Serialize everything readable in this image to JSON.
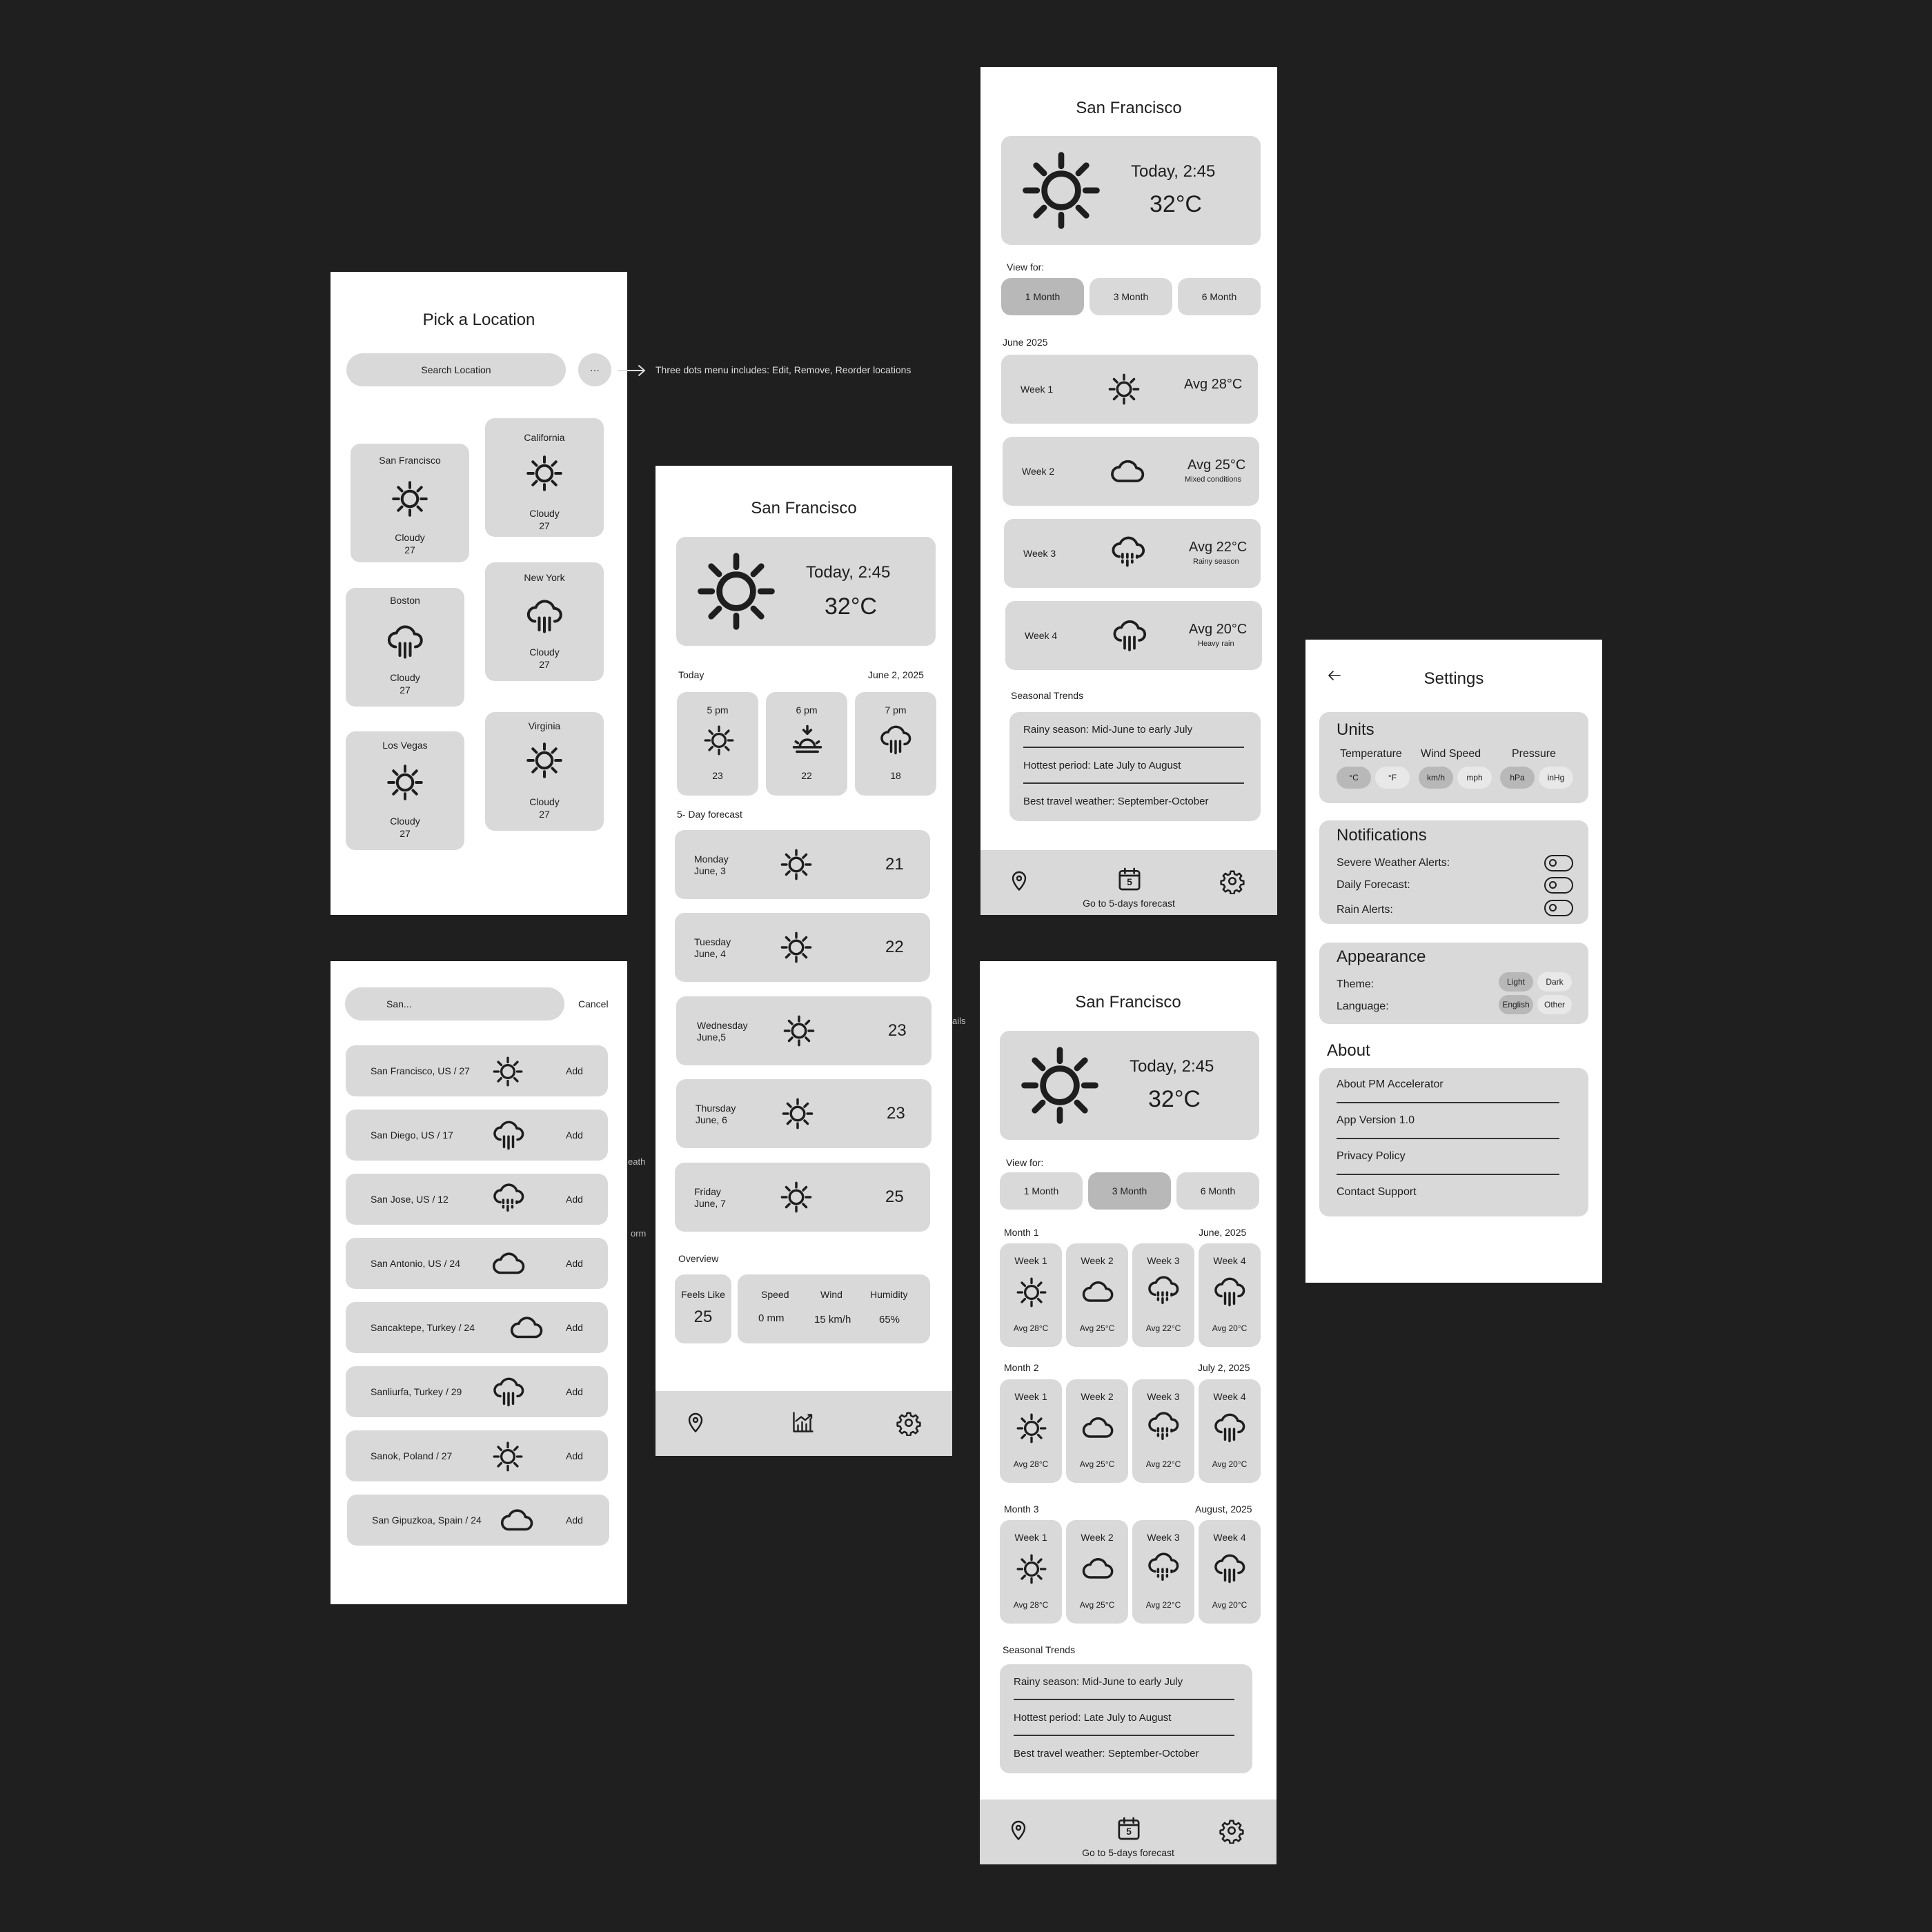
{
  "pick": {
    "title": "Pick a Location",
    "search_placeholder": "Search Location",
    "more": "···",
    "annotation": "Three dots menu includes: Edit, Remove, Reorder locations",
    "cards": [
      {
        "name": "San Francisco",
        "icon": "sun-icon",
        "cond": "Cloudy",
        "temp": "27"
      },
      {
        "name": "California",
        "icon": "sun-icon",
        "cond": "Cloudy",
        "temp": "27"
      },
      {
        "name": "Boston",
        "icon": "rain-cloud-icon",
        "cond": "Cloudy",
        "temp": "27"
      },
      {
        "name": "New York",
        "icon": "rain-cloud-icon",
        "cond": "Cloudy",
        "temp": "27"
      },
      {
        "name": "Los Vegas",
        "icon": "sun-icon",
        "cond": "Cloudy",
        "temp": "27"
      },
      {
        "name": "Virginia",
        "icon": "sun-icon",
        "cond": "Cloudy",
        "temp": "27"
      }
    ]
  },
  "search": {
    "query": "San...",
    "cancel": "Cancel",
    "results": [
      {
        "label": "San Francisco, US / 27",
        "icon": "sun-icon",
        "action": "Add"
      },
      {
        "label": "San Diego, US / 17",
        "icon": "rain-cloud-icon",
        "action": "Add"
      },
      {
        "label": "San Jose, US / 12",
        "icon": "heavy-rain-icon",
        "action": "Add"
      },
      {
        "label": "San Antonio, US / 24",
        "icon": "cloud-icon",
        "action": "Add"
      },
      {
        "label": "Sancaktepe, Turkey / 24",
        "icon": "cloud-icon",
        "action": "Add"
      },
      {
        "label": "Sanliurfa, Turkey / 29",
        "icon": "rain-cloud-icon",
        "action": "Add"
      },
      {
        "label": "Sanok, Poland / 27",
        "icon": "sun-icon",
        "action": "Add"
      },
      {
        "label": "San Gipuzkoa, Spain / 24",
        "icon": "cloud-icon",
        "action": "Add"
      }
    ]
  },
  "daily": {
    "city": "San Francisco",
    "hero": {
      "time": "Today, 2:45",
      "temp": "32°C"
    },
    "today_label": "Today",
    "today_date": "June 2, 2025",
    "hours": [
      {
        "time": "5 pm",
        "icon": "sun-icon",
        "temp": "23"
      },
      {
        "time": "6 pm",
        "icon": "sunset-icon",
        "temp": "22"
      },
      {
        "time": "7 pm",
        "icon": "rain-cloud-icon",
        "temp": "18"
      }
    ],
    "forecast_label": "5- Day forecast",
    "days": [
      {
        "day": "Monday",
        "date": "June, 3",
        "icon": "sun-icon",
        "temp": "21"
      },
      {
        "day": "Tuesday",
        "date": "June, 4",
        "icon": "sun-icon",
        "temp": "22"
      },
      {
        "day": "Wednesday",
        "date": "June,5",
        "icon": "sun-icon",
        "temp": "23"
      },
      {
        "day": "Thursday",
        "date": "June, 6",
        "icon": "sun-icon",
        "temp": "23"
      },
      {
        "day": "Friday",
        "date": "June, 7",
        "icon": "sun-icon",
        "temp": "25"
      }
    ],
    "overview_label": "Overview",
    "feels_label": "Feels Like",
    "feels_value": "25",
    "stats": [
      {
        "label": "Speed",
        "value": "0 mm"
      },
      {
        "label": "Wind",
        "value": "15 km/h"
      },
      {
        "label": "Humidity",
        "value": "65%"
      }
    ],
    "nav": [
      "location-pin-icon",
      "chart-icon",
      "gear-icon"
    ]
  },
  "monthly": {
    "city": "San Francisco",
    "hero": {
      "time": "Today, 2:45",
      "temp": "32°C"
    },
    "view_label": "View for:",
    "ranges": [
      "1 Month",
      "3 Month",
      "6 Month"
    ],
    "active_range": "1 Month",
    "month_label": "June 2025",
    "weeks": [
      {
        "label": "Week 1",
        "icon": "sun-icon",
        "avg": "Avg 28°C",
        "sub": ""
      },
      {
        "label": "Week 2",
        "icon": "cloud-icon",
        "avg": "Avg 25°C",
        "sub": "Mixed conditions"
      },
      {
        "label": "Week 3",
        "icon": "heavy-rain-icon",
        "avg": "Avg 22°C",
        "sub": "Rainy season"
      },
      {
        "label": "Week 4",
        "icon": "rain-cloud-icon",
        "avg": "Avg 20°C",
        "sub": "Heavy rain"
      }
    ],
    "trends_label": "Seasonal Trends",
    "trends": [
      "Rainy season: Mid-June to early July",
      "Hottest period: Late July to August",
      "Best travel weather: September-October"
    ],
    "nav_caption": "Go to 5-days forecast",
    "calendar_num": "5"
  },
  "quarter": {
    "city": "San Francisco",
    "hero": {
      "time": "Today, 2:45",
      "temp": "32°C"
    },
    "view_label": "View for:",
    "ranges": [
      "1 Month",
      "3 Month",
      "6 Month"
    ],
    "active_range": "3 Month",
    "months": [
      {
        "label": "Month 1",
        "date": "June, 2025"
      },
      {
        "label": "Month 2",
        "date": "July 2, 2025"
      },
      {
        "label": "Month 3",
        "date": "August, 2025"
      }
    ],
    "weeks": [
      {
        "label": "Week 1",
        "icon": "sun-icon",
        "avg": "Avg 28°C"
      },
      {
        "label": "Week 2",
        "icon": "cloud-icon",
        "avg": "Avg 25°C"
      },
      {
        "label": "Week 3",
        "icon": "heavy-rain-icon",
        "avg": "Avg 22°C"
      },
      {
        "label": "Week 4",
        "icon": "rain-cloud-icon",
        "avg": "Avg 20°C"
      }
    ],
    "trends_label": "Seasonal Trends",
    "trends": [
      "Rainy season: Mid-June to early July",
      "Hottest period: Late July to August",
      "Best travel weather: September-October"
    ],
    "nav_caption": "Go to 5-days forecast",
    "calendar_num": "5"
  },
  "settings": {
    "title": "Settings",
    "units": {
      "title": "Units",
      "groups": [
        {
          "label": "Temperature",
          "options": [
            "°C",
            "°F"
          ]
        },
        {
          "label": "Wind Speed",
          "options": [
            "km/h",
            "mph"
          ]
        },
        {
          "label": "Pressure",
          "options": [
            "hPa",
            "inHg"
          ]
        }
      ]
    },
    "notifications": {
      "title": "Notifications",
      "items": [
        "Severe Weather Alerts:",
        "Daily Forecast:",
        "Rain Alerts:"
      ]
    },
    "appearance": {
      "title": "Appearance",
      "theme_label": "Theme:",
      "theme_options": [
        "Light",
        "Dark"
      ],
      "language_label": "Language:",
      "language_options": [
        "English",
        "Other"
      ]
    },
    "about": {
      "title": "About",
      "items": [
        "About PM Accelerator",
        "App Version 1.0",
        "Privacy Policy",
        "Contact Support"
      ]
    }
  },
  "palette": {
    "background": "#1f1f1f",
    "card": "#d9d9d9",
    "active": "#b8b8b8",
    "frame": "#ffffff"
  },
  "artifacts": [
    "ails",
    "eath",
    "orm"
  ]
}
